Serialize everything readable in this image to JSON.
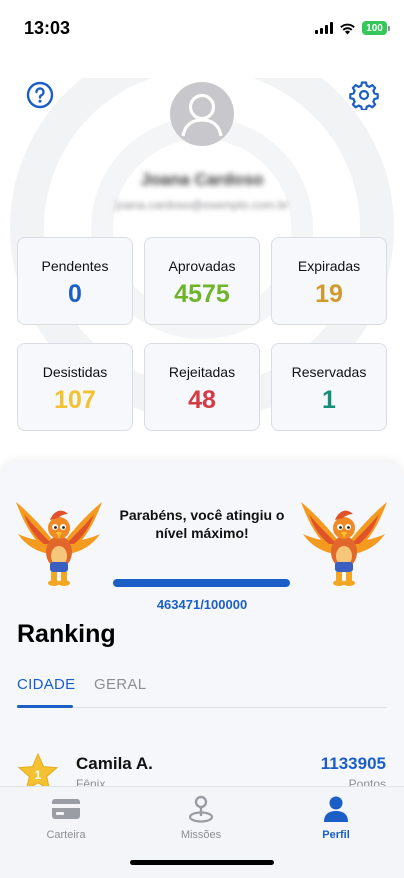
{
  "status_bar": {
    "time": "13:03",
    "battery": "100"
  },
  "profile": {
    "name": "Joana Cardoso",
    "email": "joana.cardoso@exemplo.com.br"
  },
  "stats": [
    {
      "label": "Pendentes",
      "value": "0",
      "color": "#1b5fc6"
    },
    {
      "label": "Aprovadas",
      "value": "4575",
      "color": "#6fb52c"
    },
    {
      "label": "Expiradas",
      "value": "19",
      "color": "#d19a2e"
    },
    {
      "label": "Desistidas",
      "value": "107",
      "color": "#f2c230"
    },
    {
      "label": "Rejeitadas",
      "value": "48",
      "color": "#d43a45"
    },
    {
      "label": "Reservadas",
      "value": "1",
      "color": "#168f7a"
    }
  ],
  "level": {
    "message": "Parabéns, você atingiu o nível máximo!",
    "progress_text": "463471/100000",
    "progress_fraction": 1.0
  },
  "ranking": {
    "title": "Ranking",
    "tabs": [
      {
        "label": "CIDADE",
        "active": true
      },
      {
        "label": "GERAL",
        "active": false
      }
    ],
    "rows": [
      {
        "position": "1",
        "name": "Camila A.",
        "level_name": "Fênix",
        "points": "1133905",
        "points_label": "Pontos"
      }
    ]
  },
  "tabbar": {
    "items": [
      {
        "label": "Carteira",
        "icon": "wallet-card-icon",
        "active": false
      },
      {
        "label": "Missões",
        "icon": "map-pin-icon",
        "active": false
      },
      {
        "label": "Perfil",
        "icon": "person-icon",
        "active": true
      }
    ]
  },
  "colors": {
    "accent": "#1b5fc6",
    "sheet_background": "#f5f7fa",
    "card_background": "#f6f8fb"
  }
}
